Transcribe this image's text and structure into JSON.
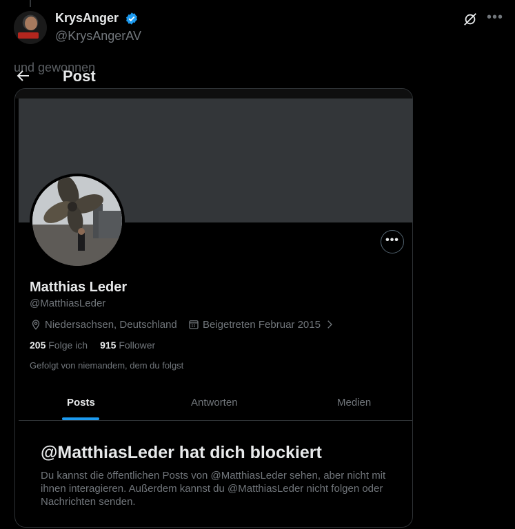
{
  "tweet": {
    "display_name": "KrysAnger",
    "handle": "@KrysAngerAV",
    "text": "und gewonnen"
  },
  "nav": {
    "title": "Post"
  },
  "profile": {
    "name": "Matthias Leder",
    "handle": "@MatthiasLeder",
    "location": "Niedersachsen, Deutschland",
    "joined": "Beigetreten Februar 2015",
    "following_count": "205",
    "following_label": "Folge ich",
    "followers_count": "915",
    "followers_label": "Follower",
    "followed_by": "Gefolgt von niemandem, dem du folgst",
    "more_label": "•••"
  },
  "tabs": [
    {
      "label": "Posts",
      "active": true
    },
    {
      "label": "Antworten",
      "active": false
    },
    {
      "label": "Medien",
      "active": false
    }
  ],
  "blocked": {
    "title": "@MatthiasLeder hat dich blockiert",
    "text": "Du kannst die öffentlichen Posts von @MatthiasLeder sehen, aber nicht mit ihnen interagieren. Außerdem kannst du @MatthiasLeder nicht folgen oder Nachrichten senden."
  },
  "top_more_label": "•••",
  "colors": {
    "accent": "#1d9bf0",
    "secondary_text": "#71767b",
    "banner": "#333639"
  },
  "icons": [
    "verified-badge-icon",
    "grok-icon",
    "more-icon",
    "back-arrow-icon",
    "location-icon",
    "calendar-icon",
    "chevron-right-icon"
  ]
}
